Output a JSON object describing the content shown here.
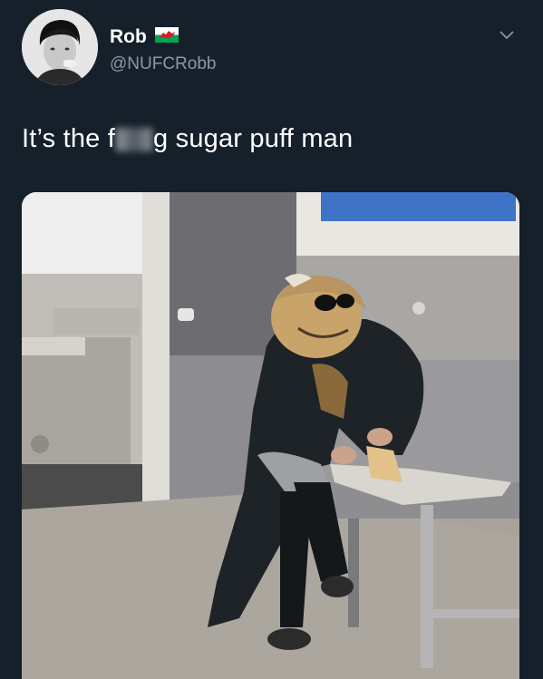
{
  "tweet": {
    "display_name": "Rob",
    "flag_icon": "wales-flag-icon",
    "handle": "@NUFCRobb",
    "text_before_censor": "It’s the f",
    "text_after_censor": "g sugar puff man",
    "menu_icon": "chevron-down-icon"
  },
  "media": {
    "description_icon": "photo"
  },
  "colors": {
    "background": "#15202b",
    "secondary_text": "#8b98a5"
  }
}
